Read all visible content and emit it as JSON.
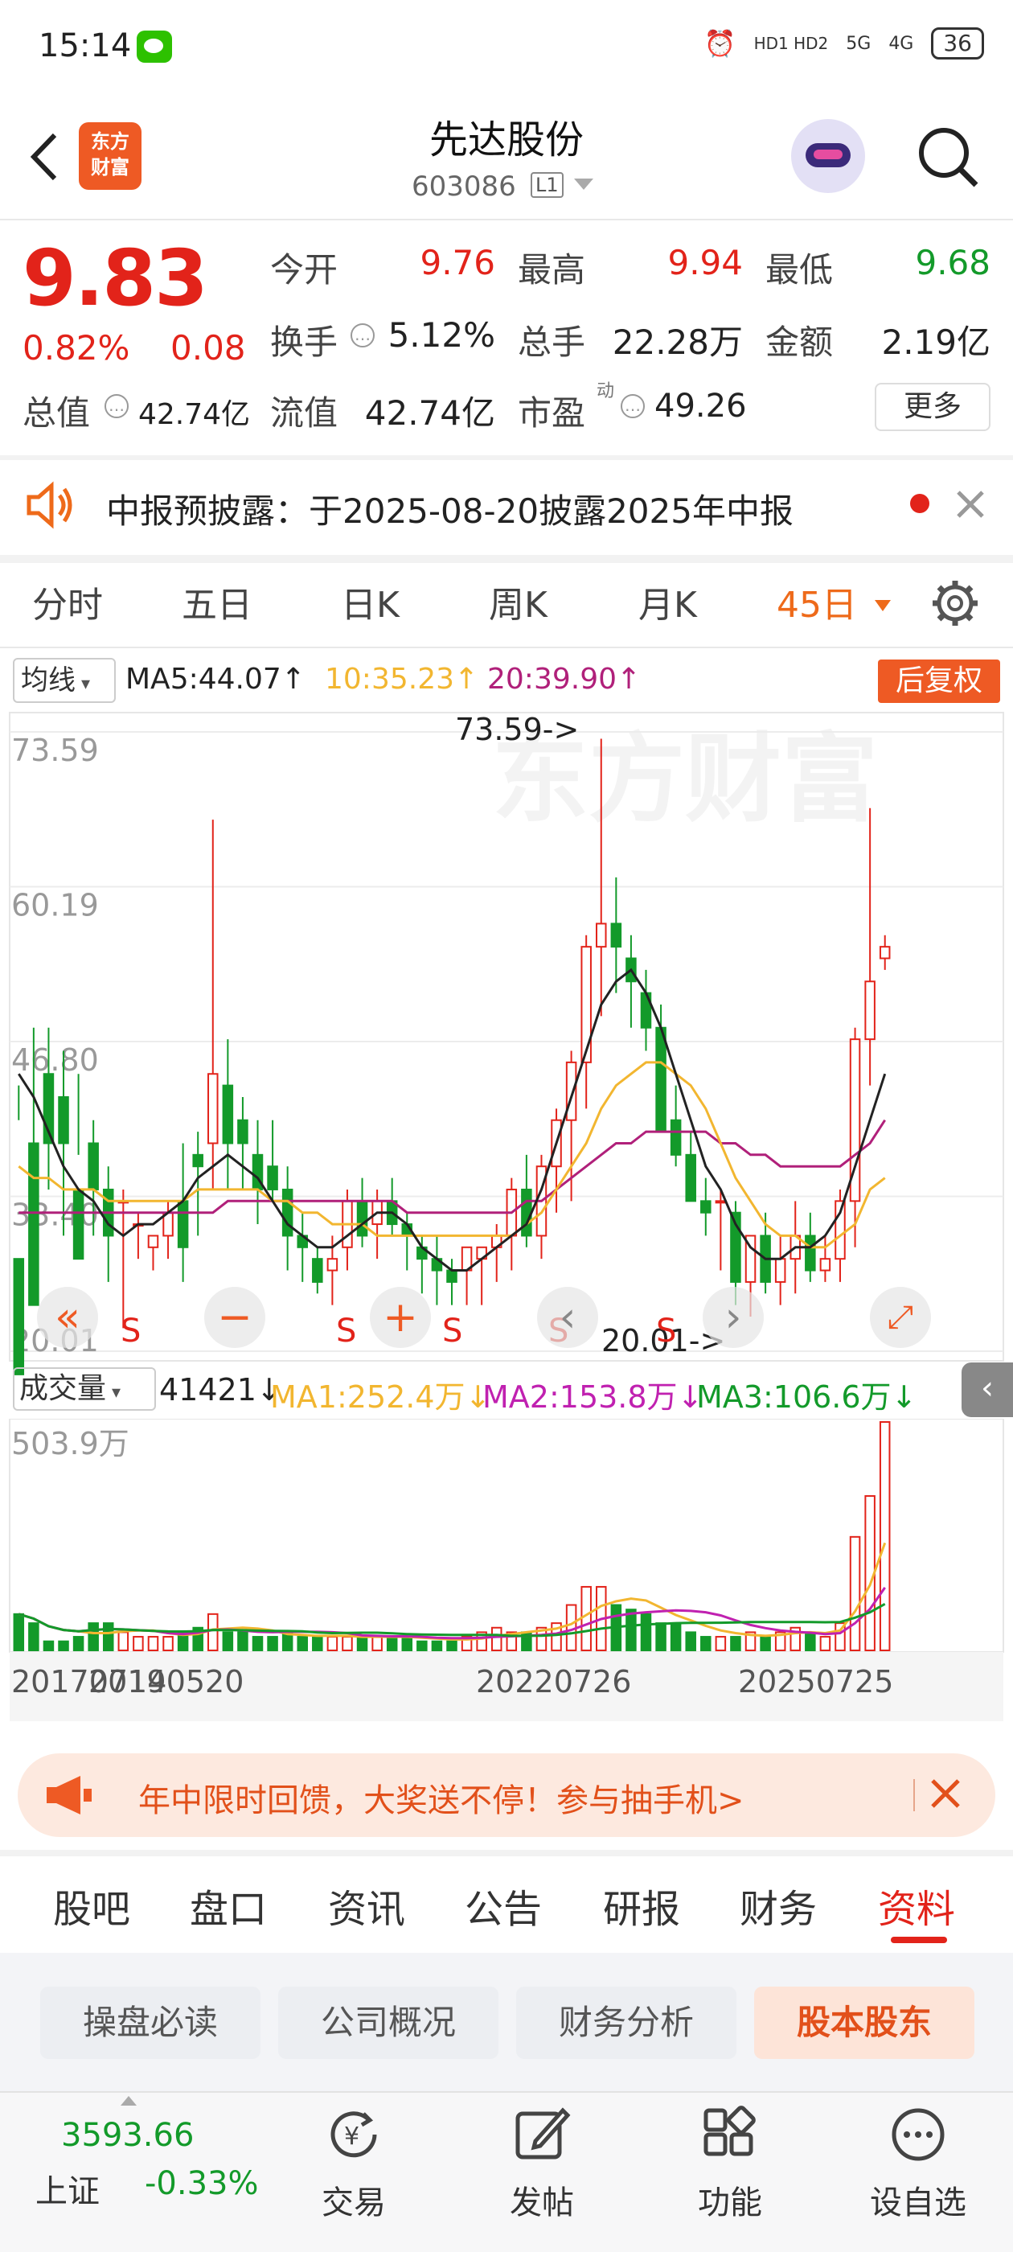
{
  "status_bar": {
    "time": "15:14",
    "network_hd": "HD1 HD2",
    "signal1": "5G",
    "signal2": "4G",
    "battery": "36"
  },
  "header": {
    "title": "先达股份",
    "code": "603086",
    "level": "L1",
    "logo_text": "东方财富"
  },
  "quote": {
    "price": "9.83",
    "change_pct": "0.82%",
    "change": "0.08",
    "open_label": "今开",
    "open": "9.76",
    "high_label": "最高",
    "high": "9.94",
    "low_label": "最低",
    "low": "9.68",
    "turnover_label": "换手",
    "turnover": "5.12%",
    "volume_label": "总手",
    "volume": "22.28万",
    "amount_label": "金额",
    "amount": "2.19亿",
    "mktcap_label": "总值",
    "mktcap": "42.74亿",
    "float_label": "流值",
    "float": "42.74亿",
    "pe_label": "市盈",
    "pe_sup": "动",
    "pe": "49.26",
    "more_label": "更多"
  },
  "notice": {
    "text": "中报预披露：于2025-08-20披露2025年中报"
  },
  "period_tabs": [
    "分时",
    "五日",
    "日K",
    "周K",
    "月K",
    "45日"
  ],
  "ma_bar": {
    "select_label": "均线",
    "ma5": "MA5:44.07↑",
    "ma10": "10:35.23↑",
    "ma20": "20:39.90↑",
    "fq_label": "后复权"
  },
  "chart_data": {
    "type": "candlestick",
    "y_ticks": [
      "73.59",
      "60.19",
      "46.80",
      "33.40",
      "20.01"
    ],
    "ylim": [
      20.01,
      73.59
    ],
    "annotations": {
      "max": "73.59->",
      "min": "20.01->"
    },
    "signal_label": "S",
    "candles": [
      [
        28,
        43,
        40,
        18
      ],
      [
        38,
        48,
        32,
        24
      ],
      [
        44,
        48,
        34,
        38
      ],
      [
        42,
        46,
        30,
        38
      ],
      [
        34,
        44,
        37,
        28
      ],
      [
        38,
        40,
        30,
        34
      ],
      [
        34,
        36,
        26,
        30
      ],
      [
        33,
        34,
        22,
        33
      ],
      [
        31,
        32,
        28,
        31
      ],
      [
        29,
        30,
        27,
        30
      ],
      [
        30,
        33,
        28,
        32
      ],
      [
        33,
        38,
        26,
        29
      ],
      [
        37,
        39,
        30,
        36
      ],
      [
        38,
        66,
        34,
        44
      ],
      [
        43,
        47,
        34,
        38
      ],
      [
        40,
        42,
        34,
        38
      ],
      [
        37,
        40,
        31,
        34
      ],
      [
        36,
        40,
        33,
        34
      ],
      [
        34,
        36,
        27,
        30
      ],
      [
        30,
        32,
        26,
        29
      ],
      [
        28,
        29,
        25,
        26
      ],
      [
        27,
        30,
        24,
        28
      ],
      [
        29,
        34,
        27,
        33
      ],
      [
        33,
        35,
        29,
        30
      ],
      [
        31,
        34,
        28,
        33
      ],
      [
        33,
        35,
        30,
        31
      ],
      [
        31,
        32,
        27,
        30
      ],
      [
        29,
        30,
        25,
        28
      ],
      [
        28,
        30,
        24,
        27
      ],
      [
        27,
        28,
        24,
        26
      ],
      [
        27,
        29,
        24,
        29
      ],
      [
        28,
        29,
        24,
        29
      ],
      [
        29,
        31,
        26,
        30
      ],
      [
        30,
        35,
        27,
        34
      ],
      [
        34,
        37,
        29,
        30
      ],
      [
        30,
        37,
        28,
        36
      ],
      [
        36,
        41,
        32,
        40
      ],
      [
        40,
        46,
        33,
        45
      ],
      [
        45,
        56,
        41,
        55
      ],
      [
        55,
        73,
        49,
        57
      ],
      [
        57,
        61,
        51,
        55
      ],
      [
        54,
        56,
        48,
        52
      ],
      [
        51,
        53,
        46,
        48
      ],
      [
        48,
        50,
        41,
        39
      ],
      [
        40,
        43,
        36,
        37
      ],
      [
        37,
        39,
        33,
        33
      ],
      [
        33,
        35,
        30,
        32
      ],
      [
        33,
        34,
        27,
        33
      ],
      [
        32,
        33,
        24,
        26
      ],
      [
        26,
        30,
        23,
        30
      ],
      [
        30,
        32,
        25,
        26
      ],
      [
        26,
        30,
        24,
        28
      ],
      [
        28,
        33,
        25,
        30
      ],
      [
        30,
        32,
        26,
        27
      ],
      [
        27,
        30,
        26,
        28
      ],
      [
        28,
        34,
        26,
        33
      ],
      [
        33,
        48,
        29,
        47
      ],
      [
        47,
        67,
        43,
        52
      ],
      [
        54,
        56,
        53,
        55
      ]
    ],
    "ma_lines": {
      "ma5": [
        44,
        42,
        39,
        36,
        34,
        33,
        31,
        30,
        31,
        31,
        32,
        33,
        35,
        36,
        37,
        36,
        35,
        33,
        31,
        30,
        29,
        29,
        30,
        31,
        32,
        32,
        31,
        29,
        28,
        27,
        27,
        28,
        29,
        30,
        31,
        34,
        38,
        42,
        46,
        50,
        52,
        53,
        51,
        48,
        44,
        40,
        36,
        34,
        31,
        29,
        28,
        28,
        29,
        29,
        30,
        32,
        36,
        40,
        44
      ],
      "ma10": [
        36,
        35,
        35,
        34,
        34,
        34,
        33,
        33,
        33,
        33,
        33,
        33,
        34,
        34,
        34,
        34,
        34,
        33,
        33,
        32,
        32,
        31,
        31,
        31,
        30,
        30,
        30,
        30,
        30,
        30,
        30,
        30,
        30,
        30,
        31,
        32,
        34,
        36,
        38,
        41,
        43,
        44,
        45,
        45,
        44,
        43,
        41,
        38,
        35,
        33,
        31,
        30,
        30,
        29,
        29,
        30,
        31,
        34,
        35
      ],
      "ma20": [
        32,
        32,
        32,
        32,
        32,
        32,
        32,
        32,
        32,
        32,
        32,
        32,
        32,
        32,
        33,
        33,
        33,
        33,
        33,
        33,
        33,
        33,
        33,
        33,
        33,
        33,
        32,
        32,
        32,
        32,
        32,
        32,
        32,
        32,
        33,
        33,
        34,
        35,
        36,
        37,
        38,
        38,
        39,
        39,
        39,
        39,
        39,
        38,
        38,
        37,
        37,
        36,
        36,
        36,
        36,
        36,
        37,
        38,
        40
      ]
    }
  },
  "volume_bar": {
    "select_label": "成交量",
    "vol": "41421↓",
    "ma1": "MA1:252.4万↓",
    "ma2": "MA2:153.8万↓",
    "ma3": "MA3:106.6万↓",
    "max_label": "503.9万"
  },
  "volume_data": {
    "values": [
      80,
      60,
      20,
      20,
      30,
      60,
      60,
      40,
      30,
      30,
      30,
      40,
      50,
      80,
      40,
      40,
      30,
      30,
      40,
      30,
      30,
      30,
      30,
      30,
      30,
      30,
      30,
      20,
      20,
      20,
      30,
      40,
      50,
      40,
      40,
      50,
      60,
      100,
      140,
      140,
      100,
      90,
      80,
      60,
      60,
      40,
      30,
      30,
      30,
      40,
      30,
      40,
      50,
      40,
      30,
      60,
      250,
      340,
      503
    ],
    "dates": [
      "20170714",
      "20190520",
      "20220726",
      "20250725"
    ]
  },
  "promo": {
    "text": "年中限时回馈，大奖送不停！参与抽手机>"
  },
  "bottom_tabs": [
    "股吧",
    "盘口",
    "资讯",
    "公告",
    "研报",
    "财务",
    "资料"
  ],
  "sub_tabs": [
    "操盘必读",
    "公司概况",
    "财务分析",
    "股本股东"
  ],
  "index": {
    "value": "3593.66",
    "name": "上证",
    "change": "-0.33%"
  },
  "nav": [
    "交易",
    "发帖",
    "功能",
    "设自选"
  ],
  "colors": {
    "up": "#e2231a",
    "down": "#139a2a",
    "ma5": "#222222",
    "ma10": "#f2b630",
    "ma20": "#b0207a",
    "accent": "#ee5a24"
  }
}
